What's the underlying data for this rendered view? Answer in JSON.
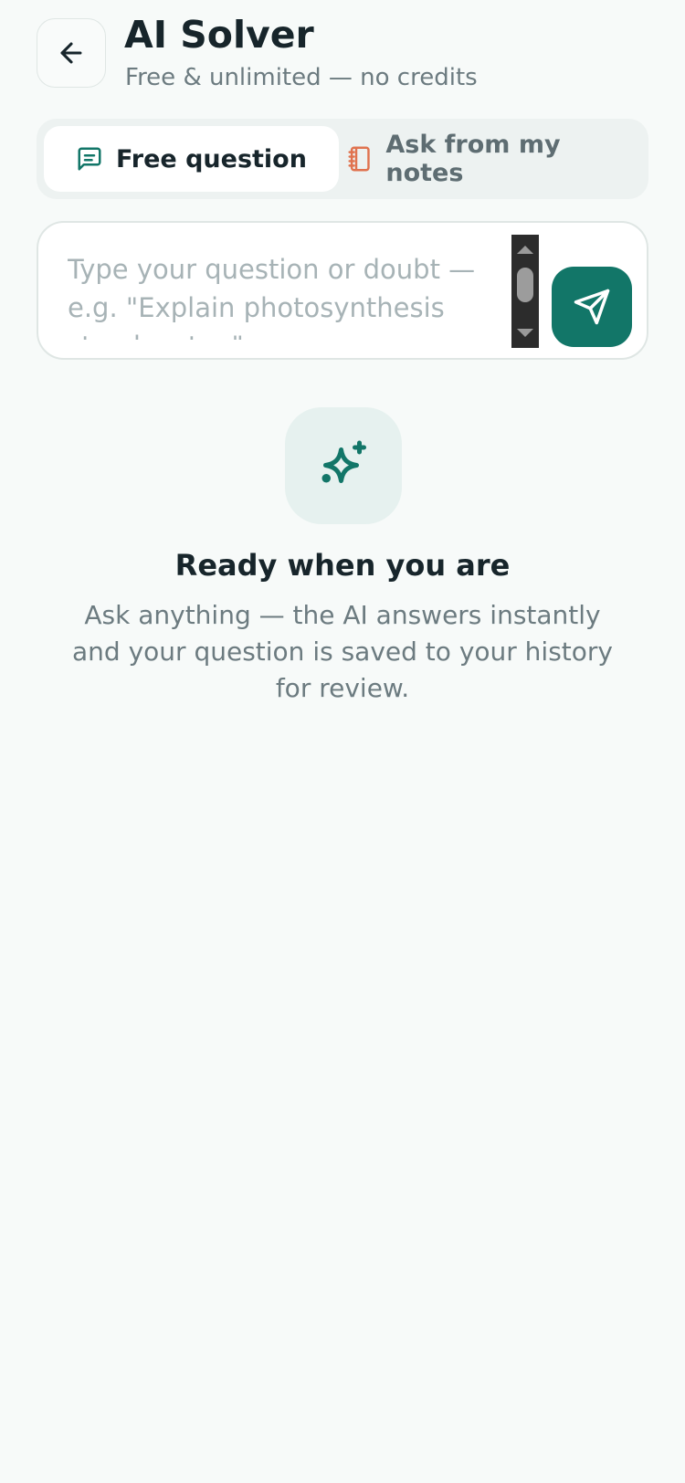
{
  "header": {
    "title": "AI Solver",
    "subtitle": "Free & unlimited — no credits",
    "back_icon": "arrow-left-icon"
  },
  "tabs": [
    {
      "label": "Free question",
      "icon": "message-square-icon",
      "selected": true
    },
    {
      "label": "Ask from my notes",
      "icon": "notebook-icon",
      "selected": false
    }
  ],
  "composer": {
    "value": "",
    "placeholder": "Type your question or doubt — e.g. \"Explain photosynthesis step by step\"",
    "send_icon": "send-icon"
  },
  "empty_state": {
    "icon": "sparkles-icon",
    "title": "Ready when you are",
    "description": "Ask anything — the AI answers instantly and your question is saved to your history for review."
  },
  "colors": {
    "accent": "#127668",
    "notes_icon": "#e0734f",
    "background": "#f7faf9"
  }
}
